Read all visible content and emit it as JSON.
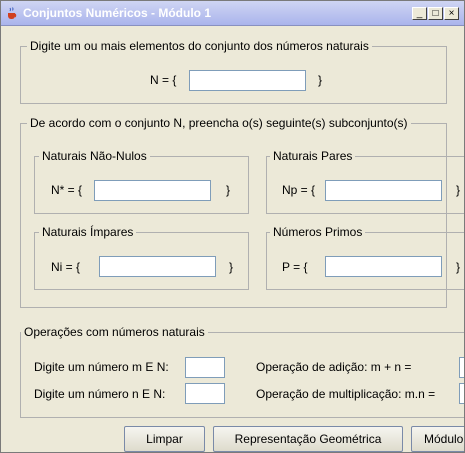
{
  "window": {
    "title": "Conjuntos Numéricos - Módulo 1",
    "icon": "java-coffee-icon",
    "controls": {
      "minimize": "_",
      "maximize": "□",
      "close": "×"
    }
  },
  "natural_input": {
    "legend": "Digite um ou mais elementos do conjunto dos números naturais",
    "prefix": "N = {",
    "suffix": "}",
    "value": ""
  },
  "subsets": {
    "legend": "De acordo com o conjunto N, preencha o(s) seguinte(s) subconjunto(s)",
    "nao_nulos": {
      "title": "Naturais Não-Nulos",
      "prefix": "N* = {",
      "suffix": "}",
      "value": ""
    },
    "pares": {
      "title": "Naturais Pares",
      "prefix": "Np = {",
      "suffix": "}",
      "value": ""
    },
    "impares": {
      "title": "Naturais Ímpares",
      "prefix": "Ni  =  {",
      "suffix": "}",
      "value": ""
    },
    "primos": {
      "title": "Números Primos",
      "prefix": "P  =  {",
      "suffix": "}",
      "value": ""
    }
  },
  "operations": {
    "legend": "Operações com números naturais",
    "m_label": "Digite um número m E N:",
    "n_label": "Digite um número n E N:",
    "add_label": "Operação de adição: m + n =",
    "mult_label": "Operação de multiplicação: m.n =",
    "m_value": "",
    "n_value": ""
  },
  "buttons": {
    "limpar": "Limpar",
    "representacao": "Representação Geométrica",
    "modulo": "Módulo"
  }
}
